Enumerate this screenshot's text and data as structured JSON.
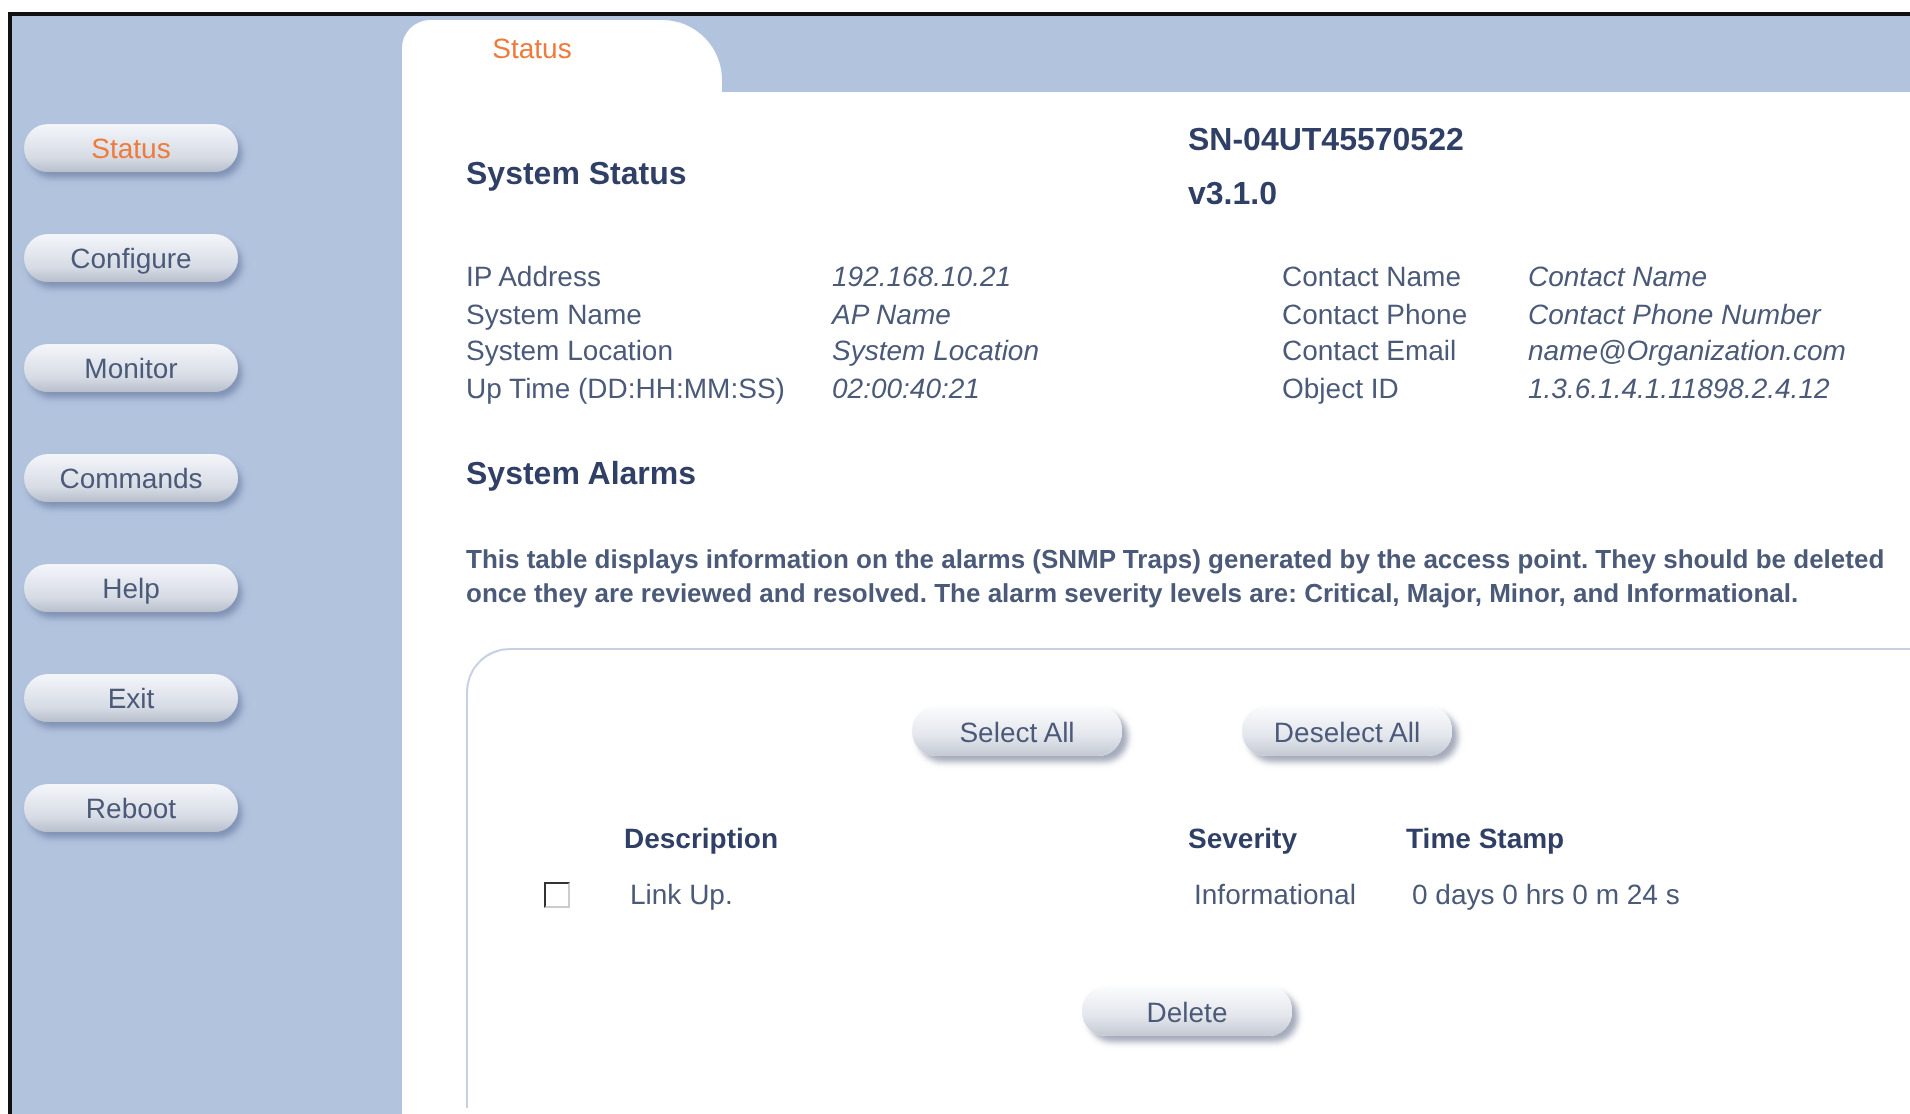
{
  "tab": {
    "label": "Status",
    "selected": true
  },
  "nav": [
    {
      "label": "Status",
      "selected": true
    },
    {
      "label": "Configure",
      "selected": false
    },
    {
      "label": "Monitor",
      "selected": false
    },
    {
      "label": "Commands",
      "selected": false
    },
    {
      "label": "Help",
      "selected": false
    },
    {
      "label": "Exit",
      "selected": false
    },
    {
      "label": "Reboot",
      "selected": false
    }
  ],
  "header": {
    "title": "System Status",
    "serial": "SN-04UT45570522",
    "version": "v3.1.0"
  },
  "info_left": [
    {
      "label": "IP Address",
      "value": "192.168.10.21"
    },
    {
      "label": "System Name",
      "value": "AP Name"
    },
    {
      "label": "System Location",
      "value": "System Location"
    },
    {
      "label": "Up Time (DD:HH:MM:SS)",
      "value": "02:00:40:21"
    }
  ],
  "info_right": [
    {
      "label": "Contact Name",
      "value": "Contact Name"
    },
    {
      "label": "Contact Phone",
      "value": "Contact Phone Number"
    },
    {
      "label": "Contact Email",
      "value": "name@Organization.com"
    },
    {
      "label": "Object ID",
      "value": "1.3.6.1.4.1.11898.2.4.12"
    }
  ],
  "alarms": {
    "title": "System Alarms",
    "description": "This table displays information on the alarms (SNMP Traps) generated by the access point. They should be deleted once they are reviewed and resolved. The alarm severity levels are: Critical, Major, Minor, and Informational.",
    "buttons": [
      "Select All",
      "Deselect All"
    ],
    "columns": [
      "Description",
      "Severity",
      "Time Stamp"
    ],
    "rows": [
      {
        "checked": false,
        "description": "Link Up.",
        "severity": "Informational",
        "time_stamp": "0 days 0 hrs 0 m 24 s"
      }
    ],
    "delete_button": "Delete"
  }
}
